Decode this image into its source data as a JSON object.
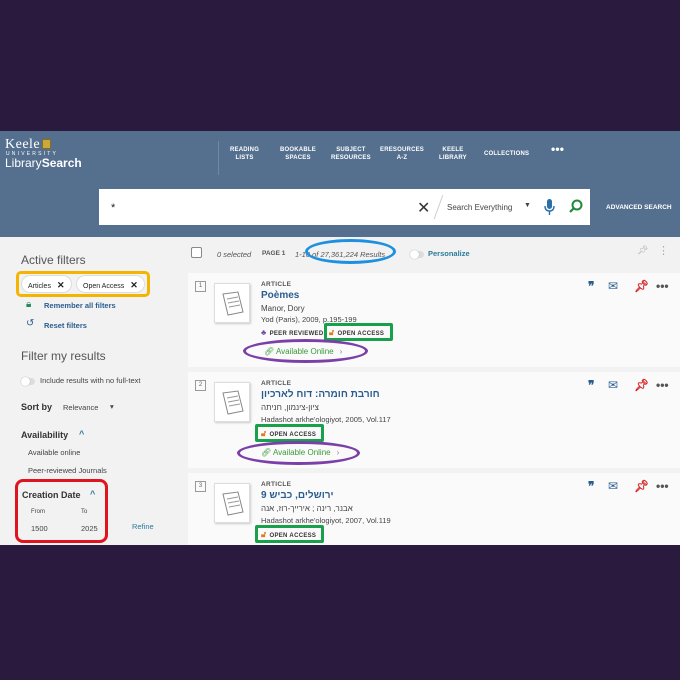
{
  "header": {
    "logo": {
      "line1": "Keele",
      "line2": "UNIVERSITY",
      "line3_a": "Library",
      "line3_b": "Search"
    },
    "nav": [
      "READING\nLISTS",
      "BOOKABLE\nSPACES",
      "SUBJECT\nRESOURCES",
      "ERESOURCES\nA-Z",
      "KEELE\nLIBRARY",
      "COLLECTIONS",
      "•••"
    ],
    "nav_items": [
      {
        "l1": "READING",
        "l2": "LISTS"
      },
      {
        "l1": "BOOKABLE",
        "l2": "SPACES"
      },
      {
        "l1": "SUBJECT",
        "l2": "RESOURCES"
      },
      {
        "l1": "ERESOURCES",
        "l2": "A-Z"
      },
      {
        "l1": "KEELE",
        "l2": "LIBRARY"
      },
      {
        "l1": "COLLECTIONS",
        "l2": ""
      }
    ],
    "nav_more": "•••",
    "search": {
      "value": "*",
      "scope": "Search Everything",
      "clear": "✕"
    },
    "advanced_search": "ADVANCED SEARCH"
  },
  "sidebar": {
    "active_filters_title": "Active filters",
    "chips": [
      "Articles",
      "Open Access"
    ],
    "remember_all_filters": "Remember all filters",
    "reset_filters": "Reset filters",
    "filter_title": "Filter my results",
    "include_no_fulltext": "Include results with no full-text",
    "sort_by_label": "Sort by",
    "sort_by_value": "Relevance",
    "availability_title": "Availability",
    "availability_items": [
      "Available online",
      "Peer-reviewed Journals"
    ],
    "creation_date_title": "Creation Date",
    "from_label": "From",
    "to_label": "To",
    "from_value": "1500",
    "to_value": "2025",
    "refine": "Refine"
  },
  "toolbar": {
    "selected": "0 selected",
    "page": "PAGE 1",
    "range": "1-10",
    "results": "of 27,361,224 Results",
    "personalize": "Personalize"
  },
  "results": [
    {
      "num": "1",
      "type": "ARTICLE",
      "title": "Poèmes",
      "author": "Manor, Dory",
      "source": "Yod (Paris), 2009, p.195-199",
      "peer_reviewed": "PEER REVIEWED",
      "open_access": "OPEN ACCESS",
      "available": "Available Online"
    },
    {
      "num": "2",
      "type": "ARTICLE",
      "title": "חורבת חומרה: דוח לארכיון",
      "author": "ציון-צינמון, חניתה",
      "source": "Hadashot arkhe'ologiyot, 2005, Vol.117",
      "open_access": "OPEN ACCESS",
      "available": "Available Online"
    },
    {
      "num": "3",
      "type": "ARTICLE",
      "title": "ירושלים, כביש 9",
      "author": "אבנר, רינה ; אירייך-רוז, אנה",
      "source": "Hadashot arkhe'ologiyot, 2007, Vol.119",
      "open_access": "OPEN ACCESS"
    }
  ],
  "colors": {
    "header_bg": "#55708f",
    "frame_bg": "#2a1a3e",
    "highlight_yellow": "#f5b400",
    "highlight_blue": "#1e90e0",
    "highlight_green": "#18a04a",
    "highlight_purple": "#7b3fa8",
    "highlight_red": "#e0141e"
  }
}
